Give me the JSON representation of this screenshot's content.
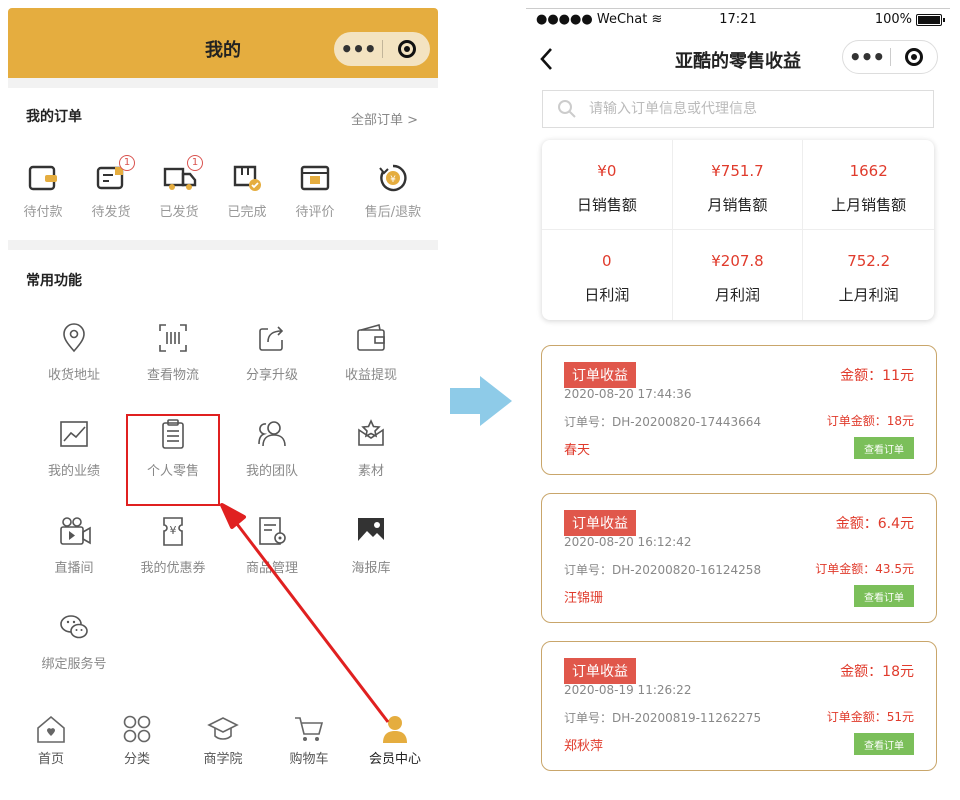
{
  "left": {
    "header": {
      "title": "我的"
    },
    "orders": {
      "title": "我的订单",
      "all_link": "全部订单 >",
      "items": [
        {
          "label": "待付款",
          "icon": "wallet-icon",
          "badge": ""
        },
        {
          "label": "待发货",
          "icon": "pending-ship-icon",
          "badge": "1"
        },
        {
          "label": "已发货",
          "icon": "truck-icon",
          "badge": "1"
        },
        {
          "label": "已完成",
          "icon": "box-check-icon",
          "badge": ""
        },
        {
          "label": "待评价",
          "icon": "review-icon",
          "badge": ""
        },
        {
          "label": "售后/退款",
          "icon": "refund-icon",
          "badge": ""
        }
      ]
    },
    "functions": {
      "title": "常用功能",
      "items": [
        {
          "label": "收货地址",
          "icon": "location-icon"
        },
        {
          "label": "查看物流",
          "icon": "barcode-icon"
        },
        {
          "label": "分享升级",
          "icon": "share-icon"
        },
        {
          "label": "收益提现",
          "icon": "wallet-withdraw-icon"
        },
        {
          "label": "我的业绩",
          "icon": "chart-icon"
        },
        {
          "label": "个人零售",
          "icon": "clipboard-icon"
        },
        {
          "label": "我的团队",
          "icon": "team-icon"
        },
        {
          "label": "素材",
          "icon": "material-icon"
        },
        {
          "label": "直播间",
          "icon": "live-camera-icon"
        },
        {
          "label": "我的优惠券",
          "icon": "coupon-icon"
        },
        {
          "label": "商品管理",
          "icon": "goods-manage-icon"
        },
        {
          "label": "海报库",
          "icon": "poster-icon"
        },
        {
          "label": "绑定服务号",
          "icon": "wechat-icon"
        }
      ]
    },
    "tabbar": [
      {
        "label": "首页",
        "icon": "home-icon"
      },
      {
        "label": "分类",
        "icon": "category-icon"
      },
      {
        "label": "商学院",
        "icon": "school-icon"
      },
      {
        "label": "购物车",
        "icon": "cart-icon"
      },
      {
        "label": "会员中心",
        "icon": "member-icon"
      }
    ],
    "tabbar_active_color": "#e5ad3f",
    "header_color": "#e5ad3f"
  },
  "right": {
    "status": {
      "carrier": "●●●●● WeChat",
      "time": "17:21",
      "battery": "100%"
    },
    "nav": {
      "title": "亚酷的零售收益"
    },
    "search": {
      "placeholder": "请输入订单信息或代理信息"
    },
    "stats": [
      {
        "value": "¥0",
        "label": "日销售额"
      },
      {
        "value": "¥751.7",
        "label": "月销售额"
      },
      {
        "value": "1662",
        "label": "上月销售额"
      },
      {
        "value": "0",
        "label": "日利润"
      },
      {
        "value": "¥207.8",
        "label": "月利润"
      },
      {
        "value": "752.2",
        "label": "上月利润"
      }
    ],
    "cards": [
      {
        "tag": "订单收益",
        "date": "2020-08-20 17:44:36",
        "order_no": "订单号：DH-20200820-17443664",
        "name": "春天",
        "amount": "金额：11元",
        "order_amount": "订单金额：18元",
        "button": "查看订单"
      },
      {
        "tag": "订单收益",
        "date": "2020-08-20 16:12:42",
        "order_no": "订单号：DH-20200820-16124258",
        "name": "汪锦珊",
        "amount": "金额：6.4元",
        "order_amount": "订单金额：43.5元",
        "button": "查看订单"
      },
      {
        "tag": "订单收益",
        "date": "2020-08-19 11:26:22",
        "order_no": "订单号：DH-20200819-11262275",
        "name": "郑秋萍",
        "amount": "金额：18元",
        "order_amount": "订单金额：51元",
        "button": "查看订单"
      }
    ],
    "accent_red": "#e03b2c",
    "tag_color": "#e0574b",
    "button_color": "#7bbf5a",
    "card_border": "#c9a66b"
  },
  "annotations": {
    "highlight_color": "#e02020",
    "arrow_color": "#8ecbe8"
  }
}
